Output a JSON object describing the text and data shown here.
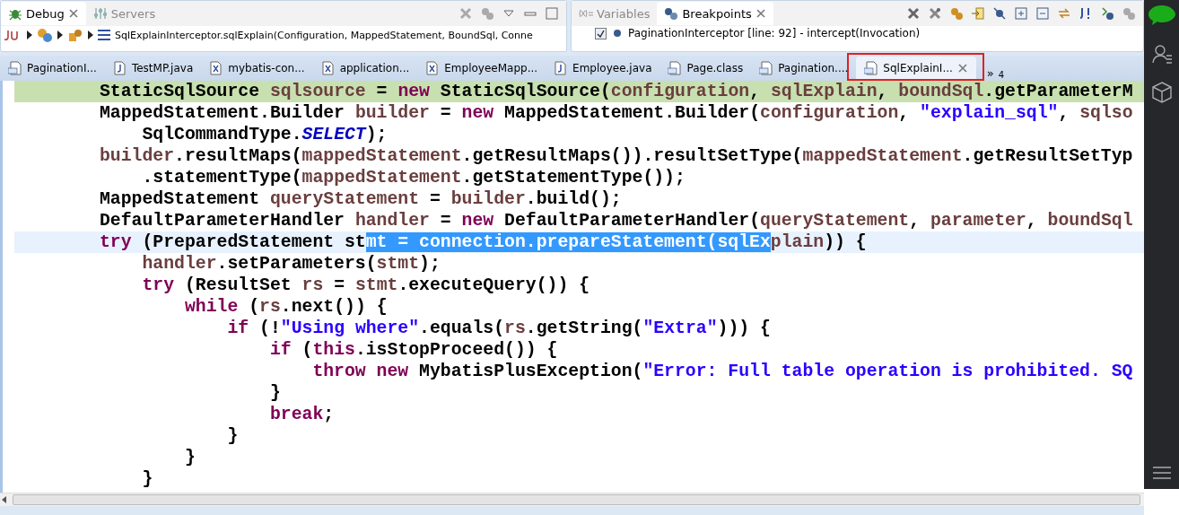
{
  "debug_view": {
    "tabs": [
      {
        "label": "Debug",
        "selected": true
      },
      {
        "label": "Servers",
        "selected": false
      }
    ],
    "breadcrumb": "SqlExplainInterceptor.sqlExplain(Configuration, MappedStatement, BoundSql, Conne"
  },
  "breakpoints_view": {
    "tabs": [
      {
        "label": "Variables",
        "selected": false
      },
      {
        "label": "Breakpoints",
        "selected": true
      }
    ],
    "breakpoints": [
      {
        "label": "PaginationInterceptor [line: 92] - intercept(Invocation)",
        "checked": true
      }
    ]
  },
  "editor_tabs": [
    {
      "label": "PaginationI...",
      "kind": "class",
      "selected": false
    },
    {
      "label": "TestMP.java",
      "kind": "java",
      "selected": false
    },
    {
      "label": "mybatis-con...",
      "kind": "xml",
      "selected": false
    },
    {
      "label": "application...",
      "kind": "xml",
      "selected": false
    },
    {
      "label": "EmployeeMapp...",
      "kind": "xml",
      "selected": false
    },
    {
      "label": "Employee.java",
      "kind": "java",
      "selected": false
    },
    {
      "label": "Page.class",
      "kind": "class",
      "selected": false
    },
    {
      "label": "Pagination....",
      "kind": "class",
      "selected": false
    },
    {
      "label": "SqlExplainI...",
      "kind": "class",
      "selected": true
    }
  ],
  "editor_overflow": {
    "icon": "»",
    "count": "4"
  },
  "code_lines": [
    {
      "execution_point": true,
      "cursor_line": false,
      "tokens": [
        {
          "text": "        StaticSqlSource ",
          "kind": "plain"
        },
        {
          "text": "sqlsource",
          "kind": "variable"
        },
        {
          "text": " = ",
          "kind": "plain"
        },
        {
          "text": "new",
          "kind": "keyword"
        },
        {
          "text": " StaticSqlSource(",
          "kind": "plain"
        },
        {
          "text": "configuration",
          "kind": "variable"
        },
        {
          "text": ", ",
          "kind": "plain"
        },
        {
          "text": "sqlExplain",
          "kind": "variable"
        },
        {
          "text": ", ",
          "kind": "plain"
        },
        {
          "text": "boundSql",
          "kind": "variable"
        },
        {
          "text": ".getParameterM",
          "kind": "plain"
        }
      ]
    },
    {
      "execution_point": false,
      "cursor_line": false,
      "tokens": [
        {
          "text": "        MappedStatement.Builder ",
          "kind": "plain"
        },
        {
          "text": "builder",
          "kind": "variable"
        },
        {
          "text": " = ",
          "kind": "plain"
        },
        {
          "text": "new",
          "kind": "keyword"
        },
        {
          "text": " MappedStatement.Builder(",
          "kind": "plain"
        },
        {
          "text": "configuration",
          "kind": "variable"
        },
        {
          "text": ", ",
          "kind": "plain"
        },
        {
          "text": "\"explain_sql\"",
          "kind": "string"
        },
        {
          "text": ", ",
          "kind": "plain"
        },
        {
          "text": "sqlso",
          "kind": "variable"
        }
      ]
    },
    {
      "execution_point": false,
      "cursor_line": false,
      "tokens": [
        {
          "text": "            SqlCommandType.",
          "kind": "plain"
        },
        {
          "text": "SELECT",
          "kind": "constant"
        },
        {
          "text": ");",
          "kind": "plain"
        }
      ]
    },
    {
      "execution_point": false,
      "cursor_line": false,
      "tokens": [
        {
          "text": "        builder",
          "kind": "variable"
        },
        {
          "text": ".resultMaps(",
          "kind": "plain"
        },
        {
          "text": "mappedStatement",
          "kind": "variable"
        },
        {
          "text": ".getResultMaps()).resultSetType(",
          "kind": "plain"
        },
        {
          "text": "mappedStatement",
          "kind": "variable"
        },
        {
          "text": ".getResultSetTyp",
          "kind": "plain"
        }
      ]
    },
    {
      "execution_point": false,
      "cursor_line": false,
      "tokens": [
        {
          "text": "            .statementType(",
          "kind": "plain"
        },
        {
          "text": "mappedStatement",
          "kind": "variable"
        },
        {
          "text": ".getStatementType());",
          "kind": "plain"
        }
      ]
    },
    {
      "execution_point": false,
      "cursor_line": false,
      "tokens": [
        {
          "text": "        MappedStatement ",
          "kind": "plain"
        },
        {
          "text": "queryStatement",
          "kind": "variable"
        },
        {
          "text": " = ",
          "kind": "plain"
        },
        {
          "text": "builder",
          "kind": "variable"
        },
        {
          "text": ".build();",
          "kind": "plain"
        }
      ]
    },
    {
      "execution_point": false,
      "cursor_line": false,
      "tokens": [
        {
          "text": "        DefaultParameterHandler ",
          "kind": "plain"
        },
        {
          "text": "handler",
          "kind": "variable"
        },
        {
          "text": " = ",
          "kind": "plain"
        },
        {
          "text": "new",
          "kind": "keyword"
        },
        {
          "text": " DefaultParameterHandler(",
          "kind": "plain"
        },
        {
          "text": "queryStatement",
          "kind": "variable"
        },
        {
          "text": ", ",
          "kind": "plain"
        },
        {
          "text": "parameter",
          "kind": "variable"
        },
        {
          "text": ", ",
          "kind": "plain"
        },
        {
          "text": "boundSql",
          "kind": "variable"
        }
      ]
    },
    {
      "execution_point": false,
      "cursor_line": true,
      "tokens": [
        {
          "text": "        try",
          "kind": "keyword"
        },
        {
          "text": " (PreparedStatement st",
          "kind": "plain"
        },
        {
          "text": "mt = connection.prepareStatement(sqlEx",
          "kind": "selection"
        },
        {
          "text": "plain",
          "kind": "variable"
        },
        {
          "text": ")) {",
          "kind": "plain"
        }
      ]
    },
    {
      "execution_point": false,
      "cursor_line": false,
      "tokens": [
        {
          "text": "            handler",
          "kind": "variable"
        },
        {
          "text": ".setParameters(",
          "kind": "plain"
        },
        {
          "text": "stmt",
          "kind": "variable"
        },
        {
          "text": ");",
          "kind": "plain"
        }
      ]
    },
    {
      "execution_point": false,
      "cursor_line": false,
      "tokens": [
        {
          "text": "            try",
          "kind": "keyword"
        },
        {
          "text": " (ResultSet ",
          "kind": "plain"
        },
        {
          "text": "rs",
          "kind": "variable"
        },
        {
          "text": " = ",
          "kind": "plain"
        },
        {
          "text": "stmt",
          "kind": "variable"
        },
        {
          "text": ".executeQuery()) {",
          "kind": "plain"
        }
      ]
    },
    {
      "execution_point": false,
      "cursor_line": false,
      "tokens": [
        {
          "text": "                while",
          "kind": "keyword"
        },
        {
          "text": " (",
          "kind": "plain"
        },
        {
          "text": "rs",
          "kind": "variable"
        },
        {
          "text": ".next()) {",
          "kind": "plain"
        }
      ]
    },
    {
      "execution_point": false,
      "cursor_line": false,
      "tokens": [
        {
          "text": "                    if",
          "kind": "keyword"
        },
        {
          "text": " (!",
          "kind": "plain"
        },
        {
          "text": "\"Using where\"",
          "kind": "string"
        },
        {
          "text": ".equals(",
          "kind": "plain"
        },
        {
          "text": "rs",
          "kind": "variable"
        },
        {
          "text": ".getString(",
          "kind": "plain"
        },
        {
          "text": "\"Extra\"",
          "kind": "string"
        },
        {
          "text": "))) {",
          "kind": "plain"
        }
      ]
    },
    {
      "execution_point": false,
      "cursor_line": false,
      "tokens": [
        {
          "text": "                        if",
          "kind": "keyword"
        },
        {
          "text": " (",
          "kind": "plain"
        },
        {
          "text": "this",
          "kind": "keyword"
        },
        {
          "text": ".isStopProceed()) {",
          "kind": "plain"
        }
      ]
    },
    {
      "execution_point": false,
      "cursor_line": false,
      "tokens": [
        {
          "text": "                            throw new",
          "kind": "keyword"
        },
        {
          "text": " MybatisPlusException(",
          "kind": "plain"
        },
        {
          "text": "\"Error: Full table operation is prohibited. SQ",
          "kind": "string"
        }
      ]
    },
    {
      "execution_point": false,
      "cursor_line": false,
      "tokens": [
        {
          "text": "                        }",
          "kind": "plain"
        }
      ]
    },
    {
      "execution_point": false,
      "cursor_line": false,
      "tokens": [
        {
          "text": "                        break",
          "kind": "keyword"
        },
        {
          "text": ";",
          "kind": "plain"
        }
      ]
    },
    {
      "execution_point": false,
      "cursor_line": false,
      "tokens": [
        {
          "text": "                    }",
          "kind": "plain"
        }
      ]
    },
    {
      "execution_point": false,
      "cursor_line": false,
      "tokens": [
        {
          "text": "                }",
          "kind": "plain"
        }
      ]
    },
    {
      "execution_point": false,
      "cursor_line": false,
      "tokens": [
        {
          "text": "            }",
          "kind": "plain"
        }
      ]
    }
  ]
}
